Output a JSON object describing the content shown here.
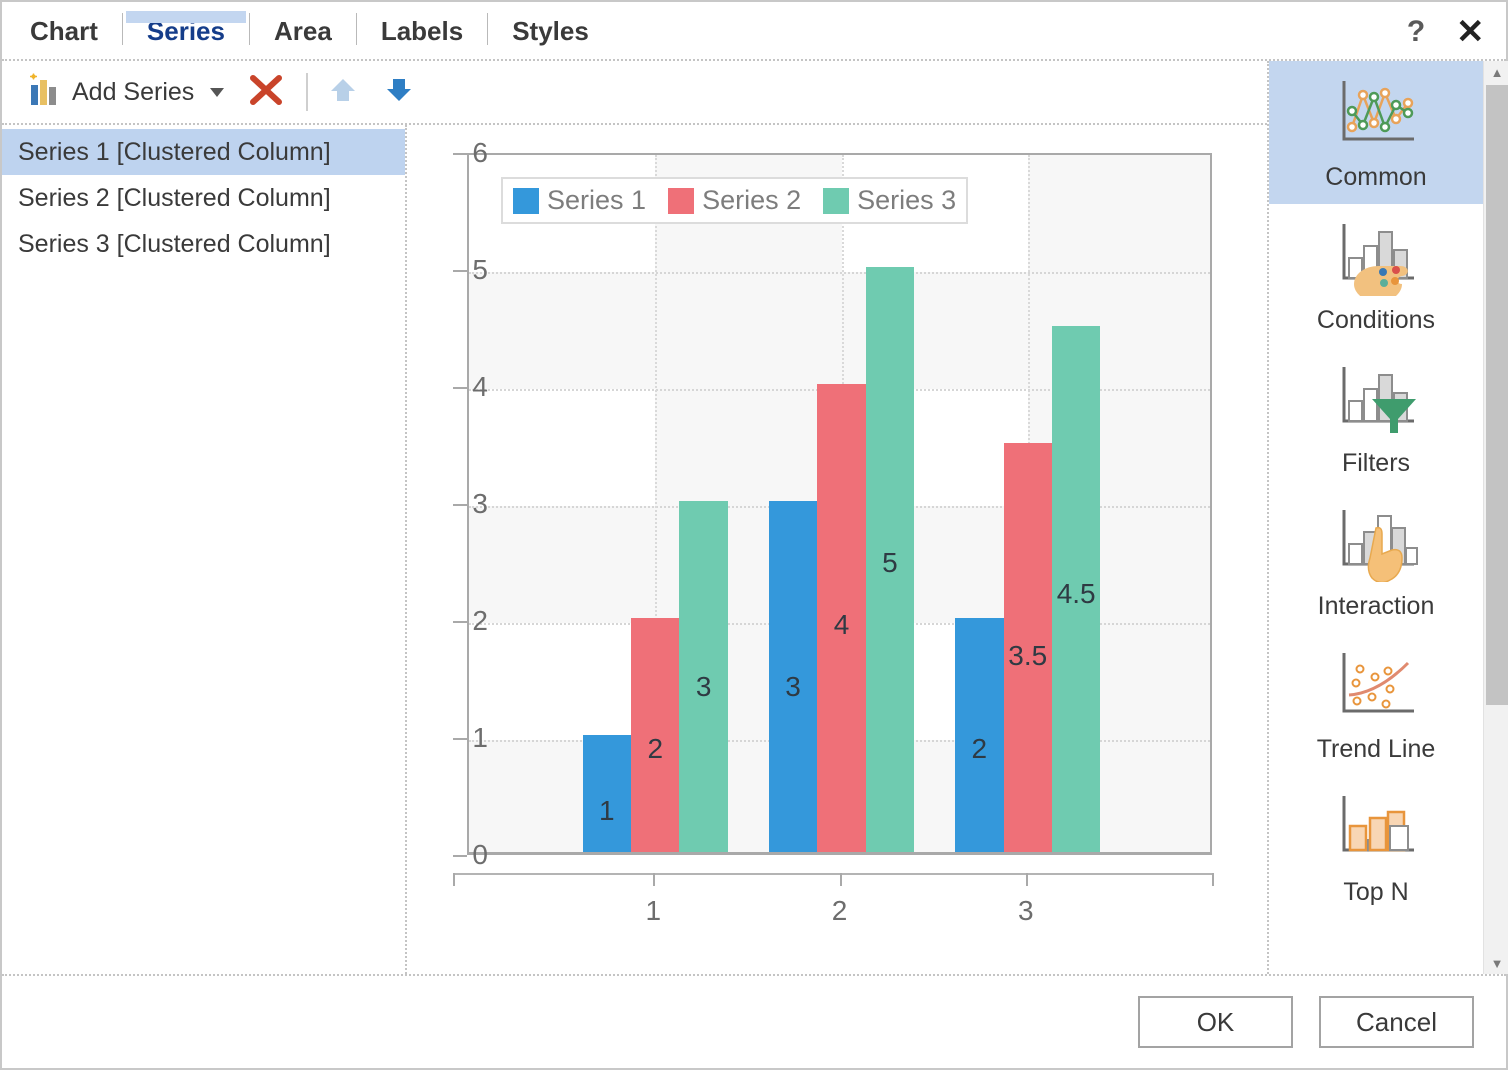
{
  "window": {
    "help_label": "?",
    "close_label": "✕"
  },
  "tabs": [
    {
      "label": "Chart",
      "active": false
    },
    {
      "label": "Series",
      "active": true
    },
    {
      "label": "Area",
      "active": false
    },
    {
      "label": "Labels",
      "active": false
    },
    {
      "label": "Styles",
      "active": false
    }
  ],
  "toolbar": {
    "add_series_label": "Add Series",
    "add_series_icon": "add-series-chart-icon",
    "dropdown_icon": "chevron-down-icon",
    "delete_icon": "red-x-delete-icon",
    "move_up_icon": "arrow-up-icon",
    "move_down_icon": "arrow-down-icon"
  },
  "series_list": {
    "items": [
      {
        "label": "Series 1 [Clustered Column]",
        "selected": true
      },
      {
        "label": "Series 2 [Clustered Column]",
        "selected": false
      },
      {
        "label": "Series 3 [Clustered Column]",
        "selected": false
      }
    ]
  },
  "categories_panel": {
    "items": [
      {
        "label": "Common",
        "icon": "line-chart-markers-icon",
        "selected": true
      },
      {
        "label": "Conditions",
        "icon": "bar-chart-palette-icon",
        "selected": false
      },
      {
        "label": "Filters",
        "icon": "bar-chart-funnel-icon",
        "selected": false
      },
      {
        "label": "Interaction",
        "icon": "bar-chart-hand-icon",
        "selected": false
      },
      {
        "label": "Trend Line",
        "icon": "scatter-trendline-icon",
        "selected": false
      },
      {
        "label": "Top N",
        "icon": "bar-chart-highlight-icon",
        "selected": false
      }
    ],
    "scroll_up_icon": "scroll-up-arrow-icon",
    "scroll_down_icon": "scroll-down-arrow-icon"
  },
  "footer": {
    "ok_label": "OK",
    "cancel_label": "Cancel"
  },
  "colors": {
    "series1": "#3498db",
    "series2": "#ef7078",
    "series3": "#6fcbb0",
    "selection": "#bed3ef",
    "tab_active_text": "#153d8a"
  },
  "chart_data": {
    "type": "bar",
    "title": "",
    "xlabel": "",
    "ylabel": "",
    "categories": [
      "1",
      "2",
      "3"
    ],
    "series": [
      {
        "name": "Series 1",
        "color": "#3498db",
        "values": [
          1,
          3,
          2
        ]
      },
      {
        "name": "Series 2",
        "color": "#ef7078",
        "values": [
          2,
          4,
          3.5
        ]
      },
      {
        "name": "Series 3",
        "color": "#6fcbb0",
        "values": [
          3,
          5,
          4.5
        ]
      }
    ],
    "ylim": [
      0,
      6
    ],
    "yticks": [
      0,
      1,
      2,
      3,
      4,
      5,
      6
    ],
    "grid": true,
    "legend_position": "top-left",
    "data_labels": true
  }
}
